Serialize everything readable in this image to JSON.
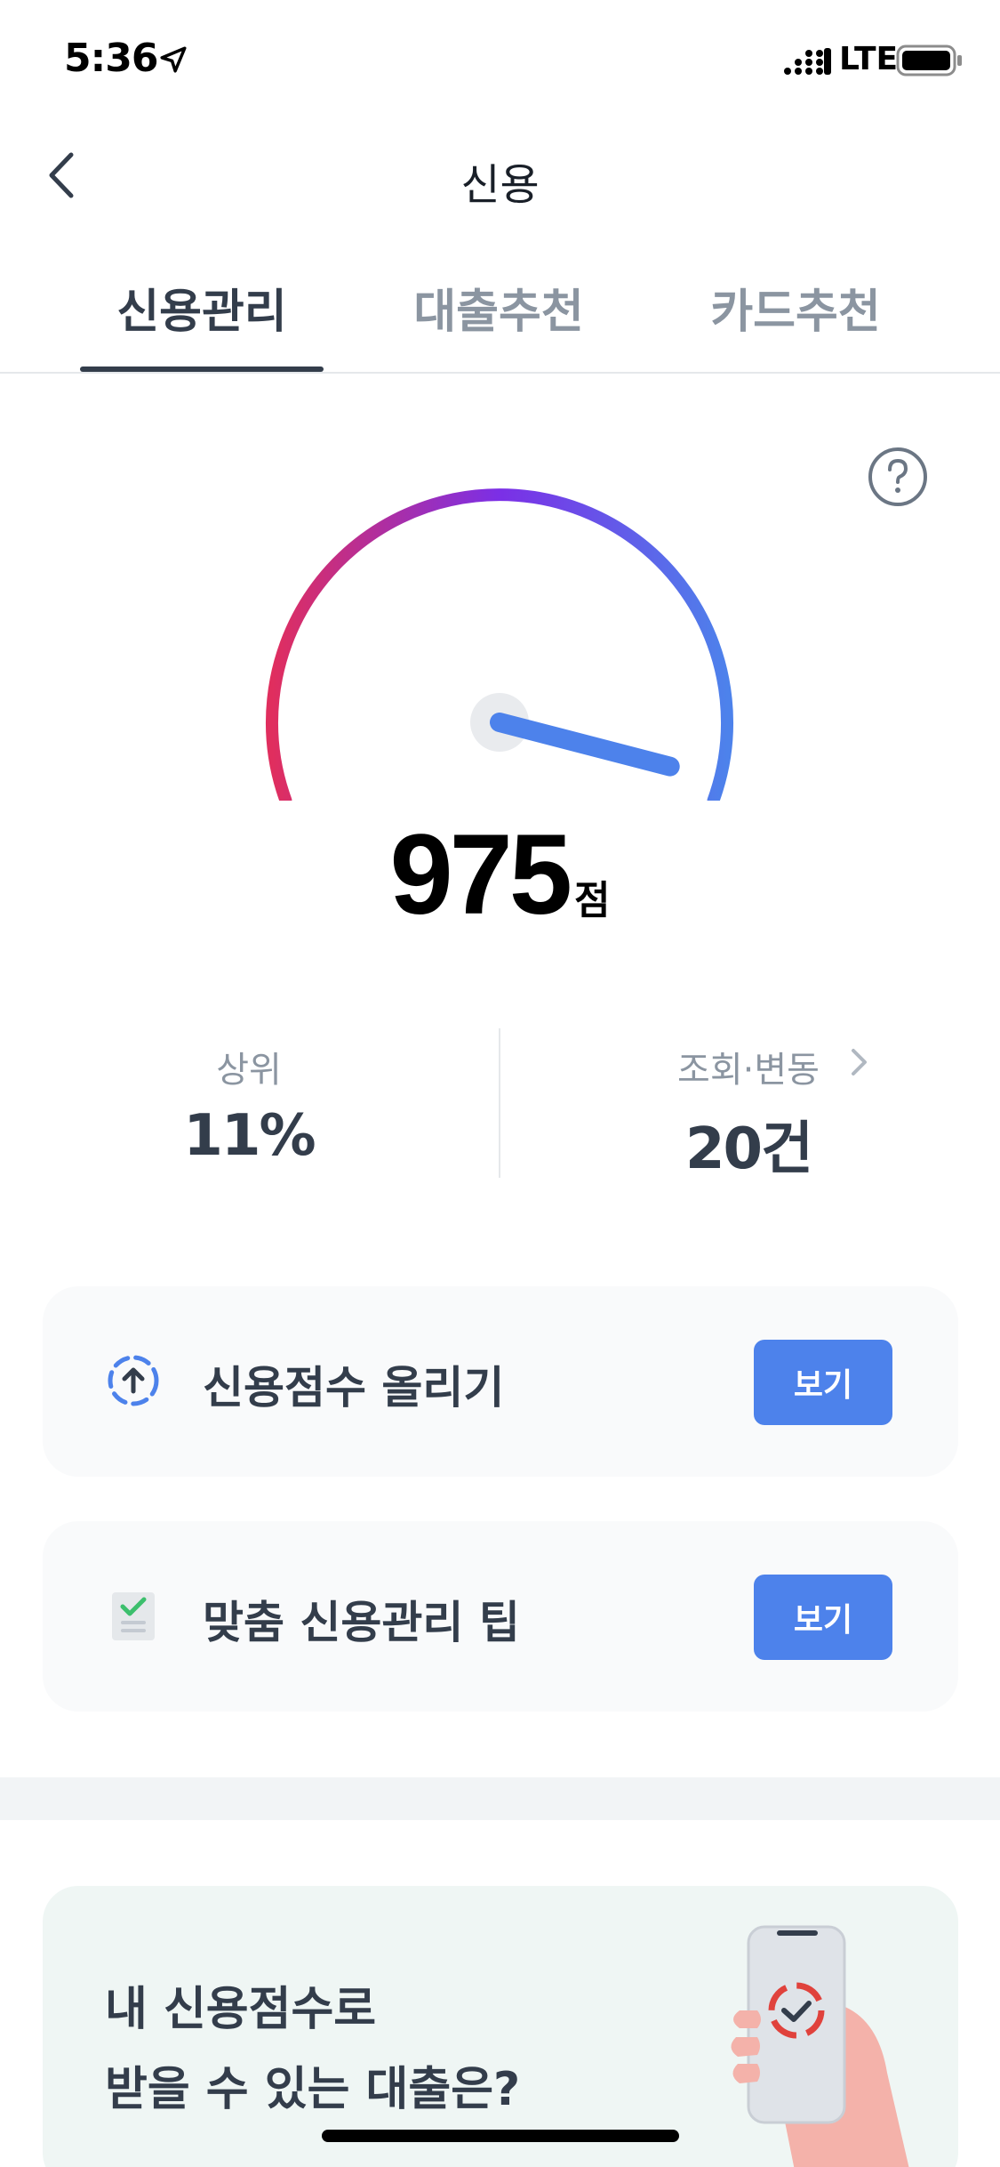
{
  "status_bar": {
    "time": "5:36",
    "network": "LTE"
  },
  "nav": {
    "title": "신용"
  },
  "tabs": [
    {
      "label": "신용관리",
      "active": true
    },
    {
      "label": "대출추천",
      "active": false
    },
    {
      "label": "카드추천",
      "active": false
    }
  ],
  "gauge": {
    "value": 975,
    "min": 0,
    "max": 1000
  },
  "score": {
    "value": "975",
    "unit": "점"
  },
  "stats": {
    "rank": {
      "label": "상위",
      "value": "11%"
    },
    "inquiries": {
      "label": "조회·변동",
      "value": "20건"
    }
  },
  "cards": [
    {
      "text": "신용점수 올리기",
      "button": "보기",
      "icon": "arrow-up-circle-icon"
    },
    {
      "text": "맞춤 신용관리 팁",
      "button": "보기",
      "icon": "checklist-icon"
    }
  ],
  "promo": {
    "line1": "내 신용점수로",
    "line2": "받을 수 있는 대출은?"
  },
  "colors": {
    "accent": "#4d82eb",
    "gauge_start": "#e02e5e",
    "gauge_mid": "#7b2fe6",
    "gauge_end": "#4d82eb",
    "text_primary": "#333d4b",
    "text_secondary": "#8b95a1"
  }
}
